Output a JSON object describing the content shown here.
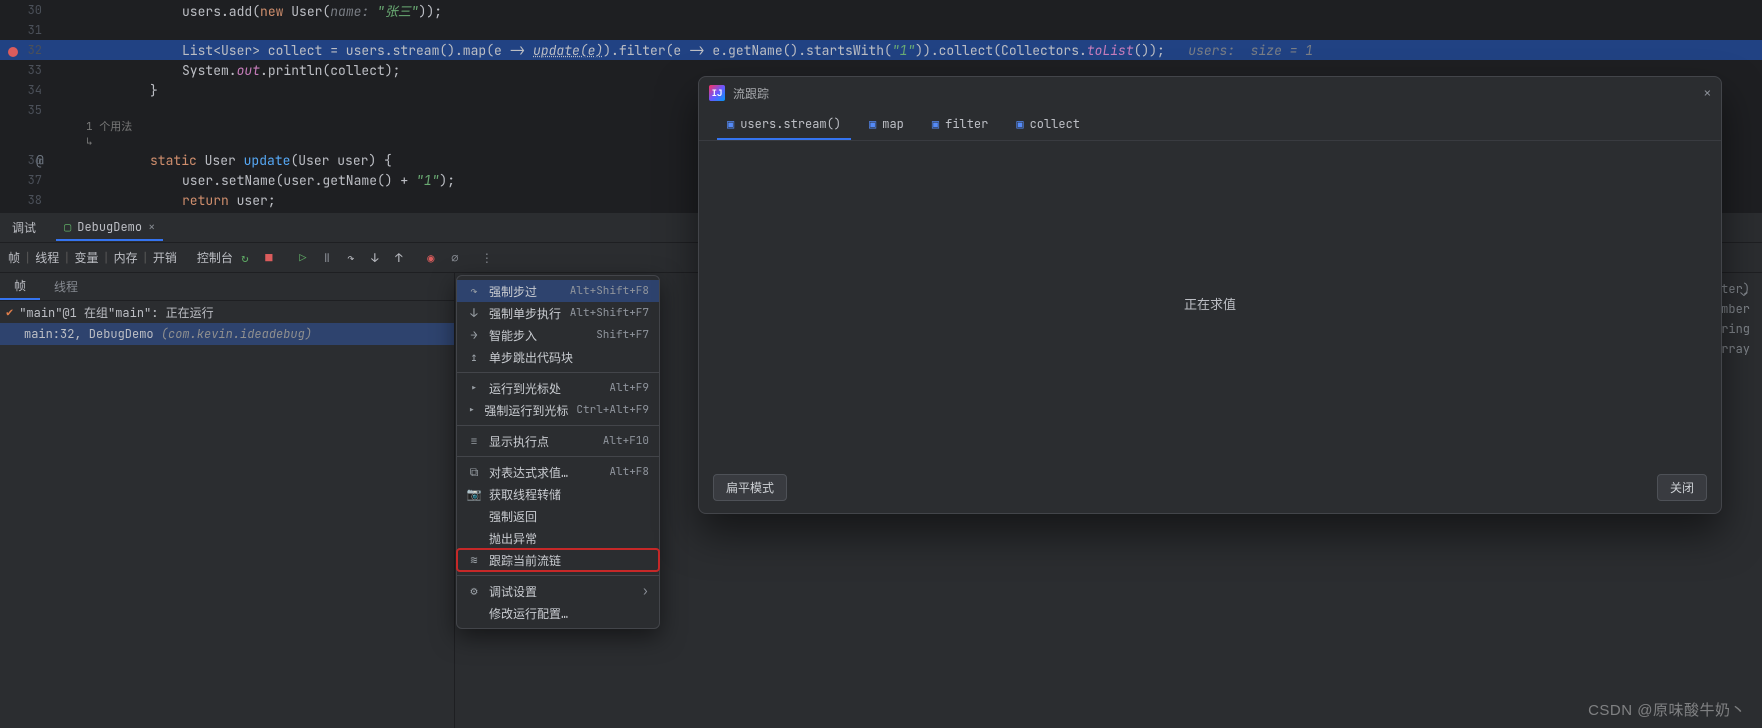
{
  "editor": {
    "lines": [
      {
        "num": "30",
        "indent": 12,
        "html": "users.add(<span class='kw'>new</span> User(<span class='comment-inline'>name: </span><span class='str'>\"张三\"</span>));"
      },
      {
        "num": "31",
        "indent": 0,
        "html": ""
      },
      {
        "num": "32",
        "indent": 12,
        "highlight": true,
        "gutterBreakpoint": true,
        "html": "List&lt;User&gt; collect = users.stream().map(e -> <span class='underline-call'>update(e)</span>).filter(e -> e.getName().startsWith(<span class='str'>\"1\"</span>)).collect(Collectors.<span class='field'>toList</span>());   <span class='comment-inline'>users:  size = 1</span>"
      },
      {
        "num": "33",
        "indent": 12,
        "html": "System.<span class='field'>out</span>.println(collect);"
      },
      {
        "num": "34",
        "indent": 8,
        "html": "}"
      },
      {
        "num": "35",
        "indent": 0,
        "html": ""
      },
      {
        "usageHint": true,
        "text": "1 个用法"
      },
      {
        "num": "36",
        "indent": 8,
        "gutterOverride": "@",
        "html": "<span class='kw'>static</span> User <span class='method'>update</span>(User user) {"
      },
      {
        "num": "37",
        "indent": 12,
        "html": "user.setName(user.getName() + <span class='str'>\"1\"</span>);"
      },
      {
        "num": "38",
        "indent": 12,
        "html": "<span class='kw'>return</span> user;"
      }
    ]
  },
  "debug": {
    "tab_label": "调试",
    "run_config": "DebugDemo",
    "toolbar_groups": [
      "帧",
      "线程",
      "变量",
      "内存",
      "开销"
    ],
    "console_label": "控制台",
    "frames": {
      "tabs": [
        "帧",
        "线程"
      ],
      "active": 0,
      "thread_line": "\"main\"@1 在组\"main\": 正在运行",
      "stack": {
        "method": "main:32, DebugDemo",
        "pkg": "(com.kevin.ideadebug)"
      }
    },
    "vars_hints": [
      "nter)",
      "ember",
      "String",
      "(Array"
    ]
  },
  "ctx": {
    "items": [
      {
        "label": "强制步过",
        "shortcut": "Alt+Shift+F8",
        "hover": true,
        "icon": "force-step-over-icon"
      },
      {
        "label": "强制单步执行",
        "shortcut": "Alt+Shift+F7",
        "icon": "force-step-into-icon"
      },
      {
        "label": "智能步入",
        "shortcut": "Shift+F7",
        "icon": "smart-step-into-icon"
      },
      {
        "label": "单步跳出代码块",
        "shortcut": "",
        "icon": "step-out-block-icon"
      },
      {
        "sep": true
      },
      {
        "label": "运行到光标处",
        "shortcut": "Alt+F9",
        "icon": "run-to-cursor-icon"
      },
      {
        "label": "强制运行到光标",
        "shortcut": "Ctrl+Alt+F9",
        "icon": "force-run-to-cursor-icon"
      },
      {
        "sep": true
      },
      {
        "label": "显示执行点",
        "shortcut": "Alt+F10",
        "icon": "show-exec-point-icon"
      },
      {
        "sep": true
      },
      {
        "label": "对表达式求值…",
        "shortcut": "Alt+F8",
        "icon": "evaluate-icon"
      },
      {
        "label": "获取线程转储",
        "shortcut": "",
        "icon": "thread-dump-icon"
      },
      {
        "label": "强制返回",
        "shortcut": "",
        "icon": ""
      },
      {
        "label": "抛出异常",
        "shortcut": "",
        "icon": ""
      },
      {
        "label": "跟踪当前流链",
        "shortcut": "",
        "icon": "trace-stream-icon",
        "boxed": true
      },
      {
        "sep": true
      },
      {
        "label": "调试设置",
        "shortcut": "",
        "icon": "settings-icon",
        "arrow": true
      },
      {
        "label": "修改运行配置…",
        "shortcut": "",
        "icon": ""
      }
    ]
  },
  "stream": {
    "title": "流跟踪",
    "tabs": [
      {
        "label": "users.stream()",
        "active": true
      },
      {
        "label": "map"
      },
      {
        "label": "filter"
      },
      {
        "label": "collect"
      }
    ],
    "body": "正在求值",
    "flat_btn": "扁平模式",
    "close_btn": "关闭"
  },
  "watermark": "CSDN @原味酸牛奶丶"
}
